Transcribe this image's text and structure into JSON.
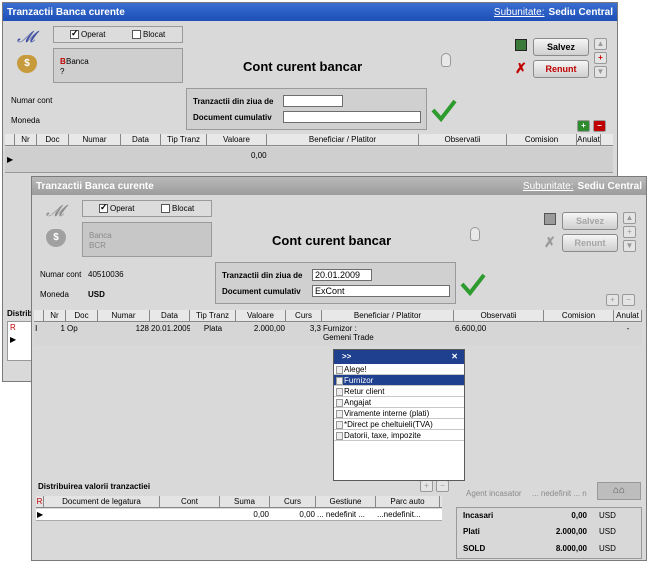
{
  "back_window": {
    "title": "Tranzactii Banca curente",
    "subunit_label": "Subunitate:",
    "subunit_value": "Sediu Central",
    "operat_label": "Operat",
    "blocat_label": "Blocat",
    "banca_label": "Banca",
    "banca_value": "?",
    "heading": "Cont curent bancar",
    "save_label": "Salvez",
    "cancel_label": "Renunt",
    "cont_label": "Numar cont",
    "moneda_label": "Moneda",
    "tranzactii_label": "Tranzactii din ziua de",
    "tranzactii_value": "",
    "document_label": "Document cumulativ",
    "document_value": "",
    "columns": [
      "Nr",
      "Doc",
      "Numar",
      "Data",
      "Tip Tranz",
      "Valoare",
      "Beneficiar / Platitor",
      "Observatii",
      "Comision",
      "Anulat"
    ],
    "row_value": "0,00",
    "distrib_label": "Distrib"
  },
  "front_window": {
    "title": "Tranzactii Banca curente",
    "subunit_label": "Subunitate:",
    "subunit_value": "Sediu Central",
    "operat_label": "Operat",
    "blocat_label": "Blocat",
    "banca_label": "Banca",
    "banca_value": "BCR",
    "heading": "Cont curent bancar",
    "save_label": "Salvez",
    "cancel_label": "Renunt",
    "cont_label": "Numar cont",
    "cont_value": "40510036",
    "moneda_label": "Moneda",
    "moneda_value": "USD",
    "tranzactii_label": "Tranzactii din ziua de",
    "tranzactii_value": "20.01.2009",
    "document_label": "Document cumulativ",
    "document_value": "ExCont",
    "columns": [
      "Nr",
      "Doc",
      "Numar",
      "Data",
      "Tip Tranz",
      "Valoare",
      "Curs",
      "Beneficiar / Platitor",
      "Observatii",
      "Comision",
      "Anulat"
    ],
    "row": {
      "nr": "1",
      "doc": "Op",
      "numar": "128",
      "data": "20.01.2009",
      "tip": "Plata",
      "valoare": "2.000,00",
      "curs": "3,3",
      "beneficiar_line1": "Furnizor :",
      "beneficiar_line2": "Gemeni Trade",
      "observatii": "6.600,00",
      "comision": "",
      "anulat": "-"
    },
    "dropdown": {
      "title": ">>",
      "items": [
        "Alege!",
        "Furnizor",
        "Retur client",
        "Angajat",
        "Viramente interne (plati)",
        "*Direct pe cheltuieli(TVA)",
        "Datorii, taxe, impozite"
      ],
      "selected_index": 1
    },
    "distrib": {
      "title": "Distribuirea valorii tranzactiei",
      "columns": [
        "R",
        "Document de legatura",
        "Cont",
        "Suma",
        "Curs",
        "Gestiune",
        "Parc auto"
      ],
      "row": {
        "suma": "0,00",
        "curs": "0,00",
        "gestiune": "... nedefinit ...",
        "parc": "...nedefinit..."
      }
    },
    "agent_label": "Agent incasator",
    "agent_value": "... nedefinit ... n",
    "summary": [
      {
        "label": "Incasari",
        "value": "0,00",
        "currency": "USD"
      },
      {
        "label": "Plati",
        "value": "2.000,00",
        "currency": "USD"
      },
      {
        "label": "SOLD",
        "value": "8.000,00",
        "currency": "USD"
      }
    ]
  }
}
